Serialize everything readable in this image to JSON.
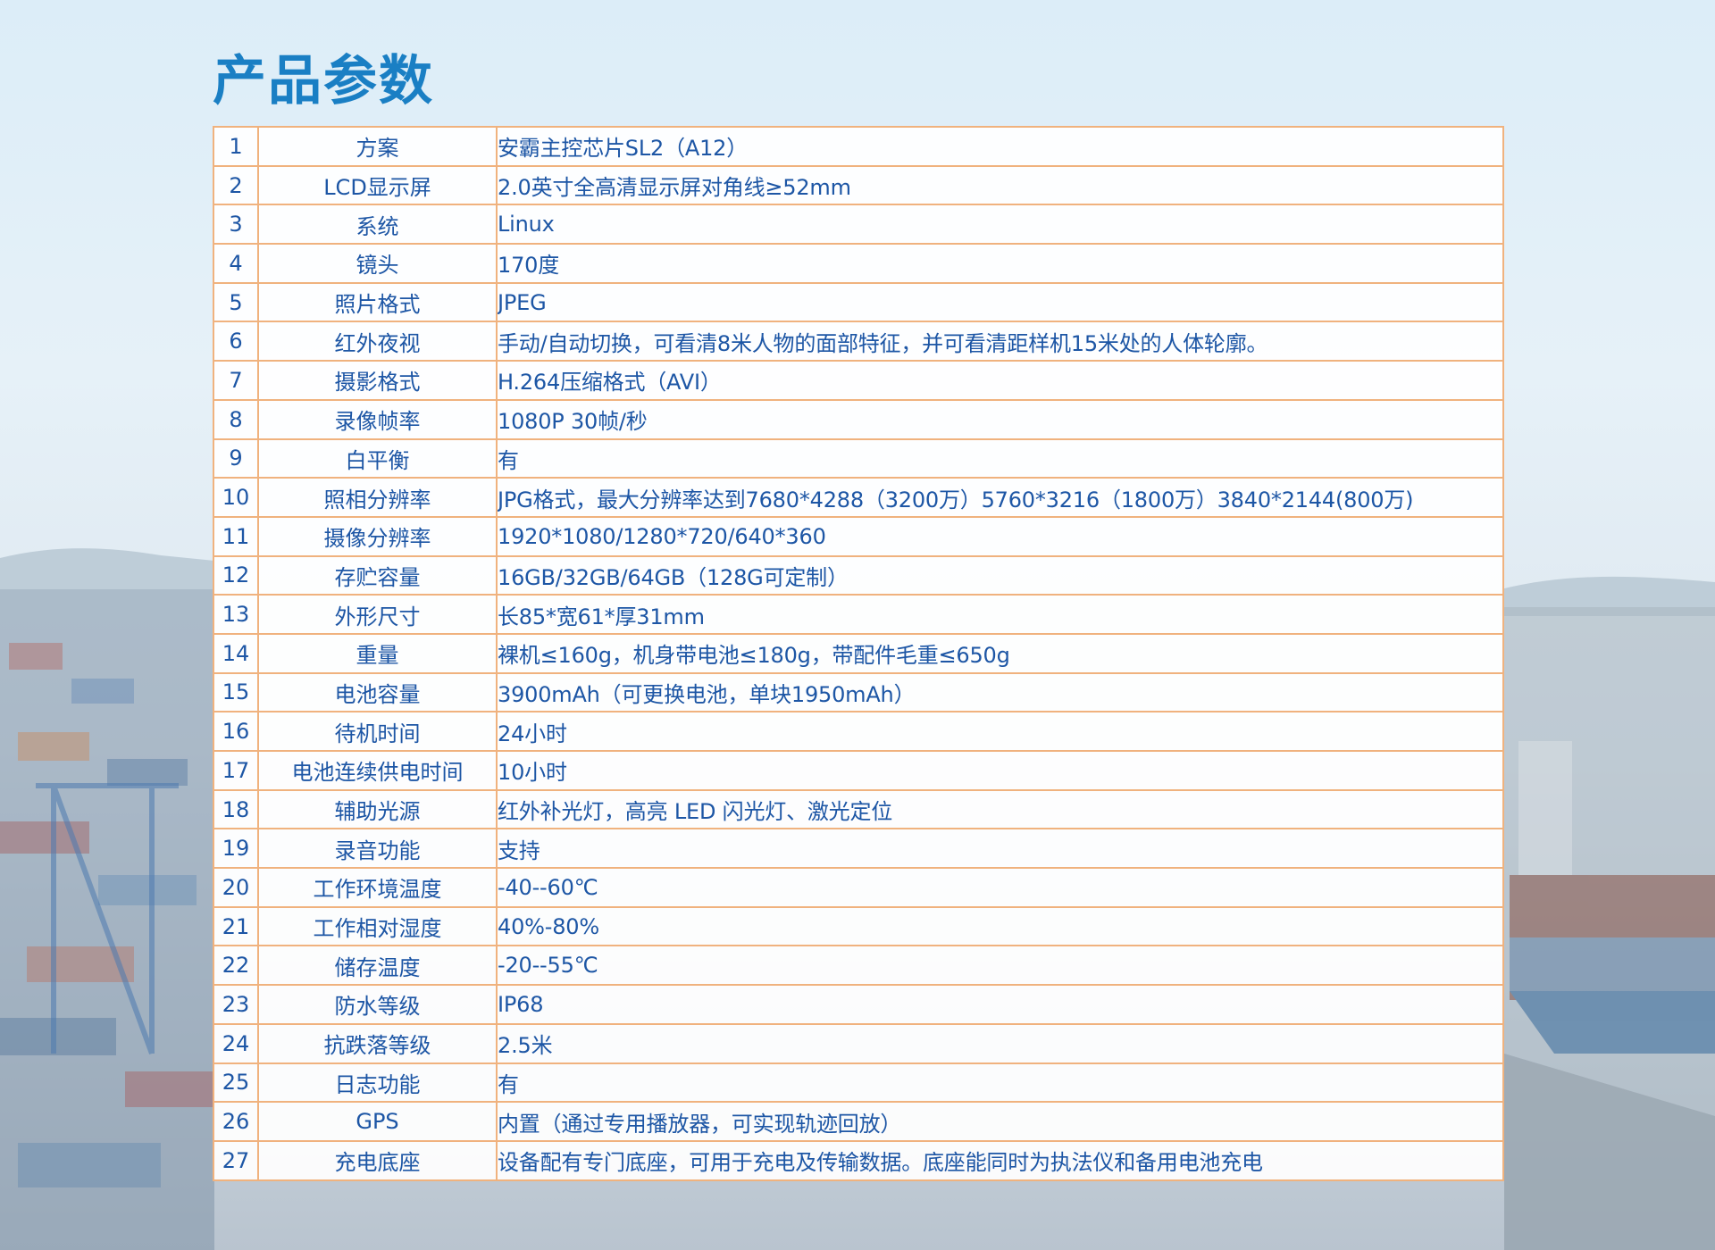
{
  "title": "产品参数",
  "rows": [
    {
      "no": "1",
      "name": "方案",
      "value": "安霸主控芯片SL2（A12）"
    },
    {
      "no": "2",
      "name": "LCD显示屏",
      "value": "2.0英寸全高清显示屏对角线≥52mm"
    },
    {
      "no": "3",
      "name": "系统",
      "value": "Linux"
    },
    {
      "no": "4",
      "name": "镜头",
      "value": "170度"
    },
    {
      "no": "5",
      "name": "照片格式",
      "value": "JPEG"
    },
    {
      "no": "6",
      "name": "红外夜视",
      "value": "手动/自动切换，可看清8米人物的面部特征，并可看清距样机15米处的人体轮廓。"
    },
    {
      "no": "7",
      "name": "摄影格式",
      "value": "H.264压缩格式（AVI）"
    },
    {
      "no": "8",
      "name": "录像帧率",
      "value": "1080P 30帧/秒"
    },
    {
      "no": "9",
      "name": "白平衡",
      "value": "有"
    },
    {
      "no": "10",
      "name": "照相分辨率",
      "value": "JPG格式，最大分辨率达到7680*4288（3200万）5760*3216（1800万）3840*2144(800万)"
    },
    {
      "no": "11",
      "name": "摄像分辨率",
      "value": "1920*1080/1280*720/640*360"
    },
    {
      "no": "12",
      "name": "存贮容量",
      "value": "16GB/32GB/64GB（128G可定制）"
    },
    {
      "no": "13",
      "name": "外形尺寸",
      "value": "长85*宽61*厚31mm"
    },
    {
      "no": "14",
      "name": "重量",
      "value": "裸机≤160g，机身带电池≤180g，带配件毛重≤650g"
    },
    {
      "no": "15",
      "name": "电池容量",
      "value": "3900mAh（可更换电池，单块1950mAh）"
    },
    {
      "no": "16",
      "name": "待机时间",
      "value": "24小时"
    },
    {
      "no": "17",
      "name": "电池连续供电时间",
      "value": "10小时"
    },
    {
      "no": "18",
      "name": "辅助光源",
      "value": "红外补光灯，高亮 LED 闪光灯、激光定位"
    },
    {
      "no": "19",
      "name": "录音功能",
      "value": "支持"
    },
    {
      "no": "20",
      "name": "工作环境温度",
      "value": "-40--60℃"
    },
    {
      "no": "21",
      "name": "工作相对湿度",
      "value": "40%-80%"
    },
    {
      "no": "22",
      "name": "储存温度",
      "value": "-20--55℃"
    },
    {
      "no": "23",
      "name": "防水等级",
      "value": "IP68"
    },
    {
      "no": "24",
      "name": "抗跌落等级",
      "value": "2.5米"
    },
    {
      "no": "25",
      "name": "日志功能",
      "value": "有"
    },
    {
      "no": "26",
      "name": "GPS",
      "value": "内置（通过专用播放器，可实现轨迹回放）"
    },
    {
      "no": "27",
      "name": "充电底座",
      "value": "设备配有专门底座，可用于充电及传输数据。底座能同时为执法仪和备用电池充电"
    }
  ]
}
